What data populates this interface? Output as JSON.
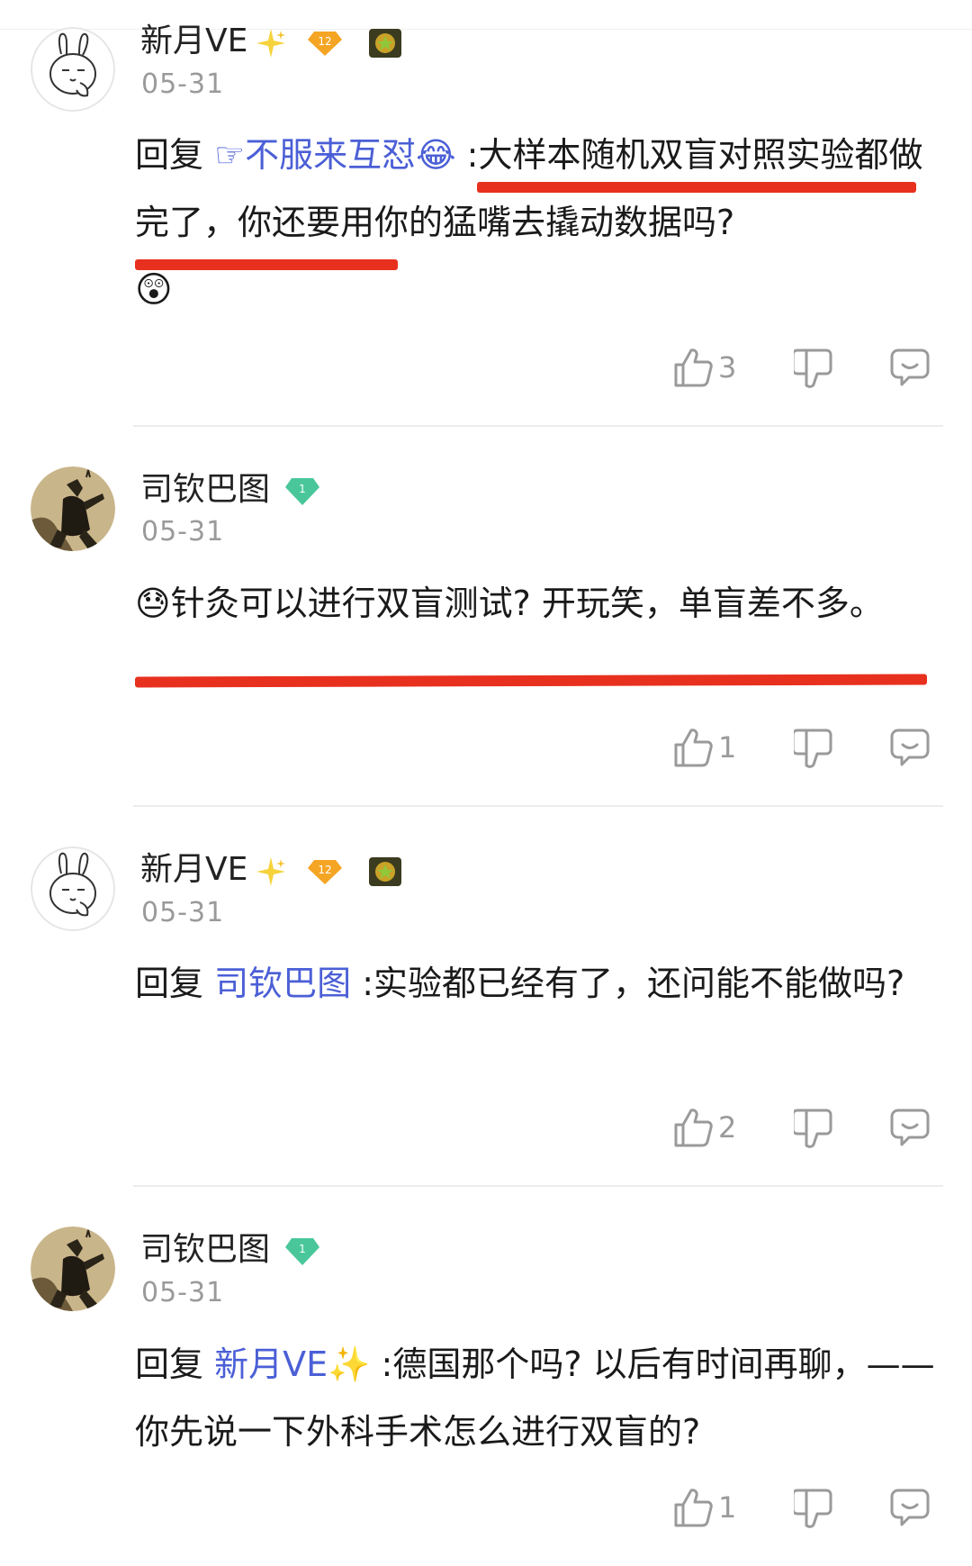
{
  "comments": [
    {
      "username": "新月VE",
      "date": "05-31",
      "reply_prefix": "回复 ",
      "mention": "☞不服来互怼",
      "mention_emoji": "😂",
      "text": " :大样本随机双盲对照实验都做完了，你还要用你的猛嘴去撬动数据吗?",
      "trailing_emoji": "😲",
      "likes": "3",
      "level_badge": "12",
      "colors": {
        "mention": "#4b5fd6",
        "underline": "#e8301f"
      }
    },
    {
      "username": "司钦巴图",
      "date": "05-31",
      "lead_emoji": "😓",
      "text": "针灸可以进行双盲测试? 开玩笑，单盲差不多。",
      "likes": "1",
      "level_badge": "1"
    },
    {
      "username": "新月VE",
      "date": "05-31",
      "reply_prefix": "回复 ",
      "mention": "司钦巴图",
      "text": " :实验都已经有了，还问能不能做吗?",
      "likes": "2",
      "level_badge": "12"
    },
    {
      "username": "司钦巴图",
      "date": "05-31",
      "reply_prefix": "回复 ",
      "mention": "新月VE",
      "mention_emoji": "✨",
      "text": " :德国那个吗? 以后有时间再聊，——你先说一下外科手术怎么进行双盲的?",
      "likes": "1",
      "level_badge": "1"
    }
  ],
  "icons": {
    "like": "thumbs-up-icon",
    "dislike": "thumbs-down-icon",
    "reply": "comment-bubble-icon",
    "sparkle": "sparkle-icon",
    "level": "level-diamond-icon",
    "medal": "medal-icon",
    "gem": "green-gem-icon"
  }
}
